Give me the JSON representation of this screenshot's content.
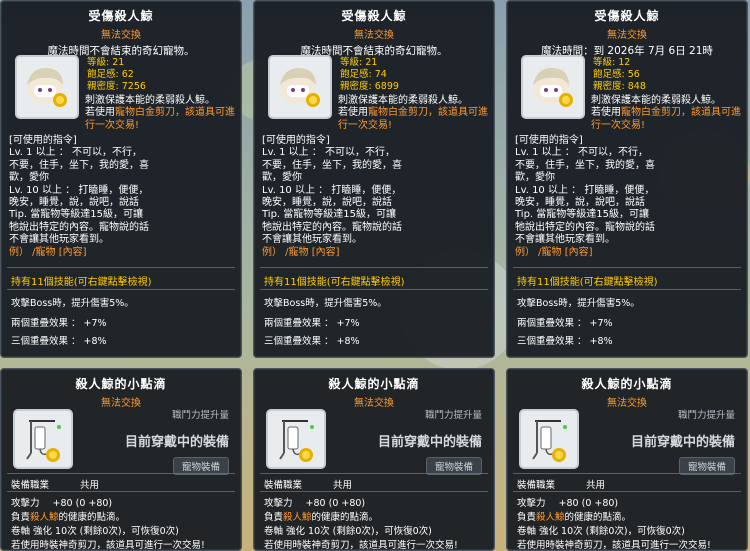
{
  "pets": [
    {
      "title": "受傷殺人鯨",
      "untradable": "無法交換",
      "magic_time": "魔法時間不會結束的奇幻寵物。",
      "level_label": "等級",
      "level": "21",
      "fullness_label": "飽足感",
      "fullness": "62",
      "intimacy_label": "親密度",
      "intimacy": "7256"
    },
    {
      "title": "受傷殺人鯨",
      "untradable": "無法交換",
      "magic_time": "魔法時間不會結束的奇幻寵物。",
      "level_label": "等級",
      "level": "21",
      "fullness_label": "飽足感",
      "fullness": "74",
      "intimacy_label": "親密度",
      "intimacy": "6899"
    },
    {
      "title": "受傷殺人鯨",
      "untradable": "無法交換",
      "magic_time": "魔法時間：到 2026年 7月 6日 21時",
      "level_label": "等級",
      "level": "12",
      "fullness_label": "飽足感",
      "fullness": "56",
      "intimacy_label": "親密度",
      "intimacy": "848"
    }
  ],
  "pet_common": {
    "stirring": "刺激保護本能的柔弱殺人鯨。",
    "scissors_prefix": "若使用",
    "scissors_item": "寵物白金剪刀",
    "scissors_suffix": "，該道具可進行一次交易!",
    "commands_header": "[可使用的指令]",
    "lv1_line1": "Lv. 1 以上 ： 不可以，不行，",
    "lv1_line2": "不要，住手，坐下，我的愛，喜",
    "lv1_line3": "歡，愛你",
    "lv10_line1": "Lv. 10 以上 ： 打瞌睡，便便，",
    "lv10_line2": "晚安，睡覺，說，說吧，說話",
    "tip_line1": "Tip. 當寵物等級達15級，可讓",
    "tip_line2": "牠說出特定的內容。寵物說的話",
    "tip_line3": "不會讓其他玩家看到。",
    "example": "例） /寵物 [內容]",
    "skills": "持有11個技能(可右鍵點擊檢視)",
    "boss_line": "攻擊Boss時，提升傷害5%。",
    "two_set": "兩個重疊效果 ： +7%",
    "three_set": "三個重疊效果 ： +8%"
  },
  "equips": [
    {
      "title": "殺人鯨的小點滴",
      "untradable": "無法交換",
      "job_power": "職鬥力提升量",
      "equipped": "目前穿戴中的裝備",
      "pill": "寵物裝備",
      "job_label": "裝備職業",
      "job_value": "共用",
      "attack_label": "攻擊力",
      "attack_value": "+80 (0 +80)",
      "note_prefix": "負責",
      "note_item": "殺人鯨",
      "note_suffix": "的健康的點滴。",
      "scroll": "卷軸 強化 10次 (剩餘0次)，可恢復0次)",
      "scissors": "若使用時裝神奇剪刀，該道具可進行一次交易!"
    },
    {
      "title": "殺人鯨的小點滴",
      "untradable": "無法交換",
      "job_power": "職鬥力提升量",
      "equipped": "目前穿戴中的裝備",
      "pill": "寵物裝備",
      "job_label": "裝備職業",
      "job_value": "共用",
      "attack_label": "攻擊力",
      "attack_value": "+80 (0 +80)",
      "note_prefix": "負責",
      "note_item": "殺人鯨",
      "note_suffix": "的健康的點滴。",
      "scroll": "卷軸 強化 10次 (剩餘0次)，可恢復0次)",
      "scissors": "若使用時裝神奇剪刀，該道具可進行一次交易!"
    },
    {
      "title": "殺人鯨的小點滴",
      "untradable": "無法交換",
      "job_power": "職鬥力提升量",
      "equipped": "目前穿戴中的裝備",
      "pill": "寵物裝備",
      "job_label": "裝備職業",
      "job_value": "共用",
      "attack_label": "攻擊力",
      "attack_value": "+80 (0 +80)",
      "note_prefix": "負責",
      "note_item": "殺人鯨",
      "note_suffix": "的健康的點滴。",
      "scroll": "卷軸 強化 10次 (剩餘0次)，可恢復0次)",
      "scissors": "若使用時裝神奇剪刀，該道具可進行一次交易!"
    }
  ],
  "colors": {
    "accent_orange": "#ff9a2e",
    "accent_yellow": "#ffcc00",
    "panel_bg": "#161a20"
  },
  "icons": {
    "pet": "pet-portrait-icon",
    "equip": "iv-drip-icon"
  }
}
